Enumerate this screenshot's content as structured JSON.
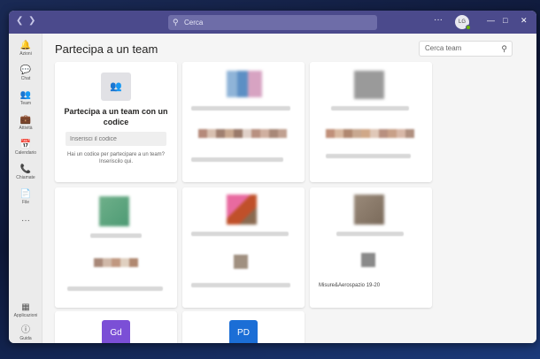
{
  "titlebar": {
    "back_icon": "chevron-left-icon",
    "forward_icon": "chevron-right-icon",
    "search_placeholder": "Cerca",
    "more_icon": "more-icon",
    "avatar_initials": "LG",
    "presence_color": "#6bb700",
    "bar_color": "#4b4a8c"
  },
  "rail": {
    "items": [
      {
        "label": "Azioni",
        "icon": "bell-icon"
      },
      {
        "label": "Chat",
        "icon": "chat-icon"
      },
      {
        "label": "Team",
        "icon": "team-icon"
      },
      {
        "label": "Attività",
        "icon": "assignments-icon"
      },
      {
        "label": "Calendario",
        "icon": "calendar-icon"
      },
      {
        "label": "Chiamate",
        "icon": "phone-icon"
      },
      {
        "label": "File",
        "icon": "file-icon"
      }
    ],
    "more": "···",
    "bottom": [
      {
        "label": "Applicazioni",
        "icon": "apps-icon"
      },
      {
        "label": "Guida",
        "icon": "help-icon"
      }
    ]
  },
  "main": {
    "title": "Partecipa a un team",
    "search_placeholder": "Cerca team",
    "join_card": {
      "title": "Partecipa a un team con un codice",
      "code_placeholder": "Inserisci il codice",
      "hint": "Hai un codice per partecipare a un team? Inseriscilo qui."
    },
    "team_cards": [
      {
        "label": ""
      },
      {
        "label": ""
      },
      {
        "label": ""
      },
      {
        "label": ""
      },
      {
        "label": ""
      },
      {
        "label": "Misure&Aerospazio 19-20"
      },
      {
        "badge": "Gd",
        "badge_color": "#7b4fd6"
      },
      {
        "badge": "PD",
        "badge_color": "#1b6ed6"
      }
    ]
  }
}
